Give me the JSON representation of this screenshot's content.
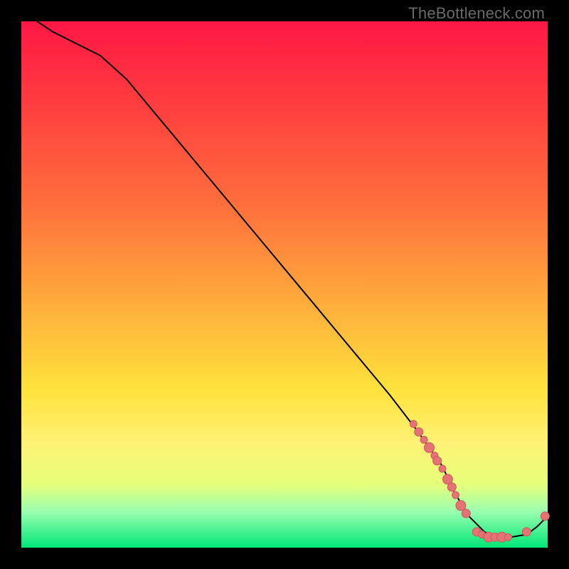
{
  "watermark": "TheBottleneck.com",
  "colors": {
    "line": "#000000",
    "dot_fill": "#e57373",
    "dot_stroke": "#c85a5a",
    "gradient_stops": [
      {
        "offset": 0.0,
        "color": "#ff1744"
      },
      {
        "offset": 0.15,
        "color": "#ff3b3f"
      },
      {
        "offset": 0.35,
        "color": "#ff6f3c"
      },
      {
        "offset": 0.55,
        "color": "#ffb13b"
      },
      {
        "offset": 0.7,
        "color": "#ffe23b"
      },
      {
        "offset": 0.8,
        "color": "#fff176"
      },
      {
        "offset": 0.88,
        "color": "#e6ff7a"
      },
      {
        "offset": 0.93,
        "color": "#9cffb0"
      },
      {
        "offset": 1.0,
        "color": "#00e676"
      }
    ]
  },
  "chart_data": {
    "type": "line",
    "title": "",
    "xlabel": "",
    "ylabel": "",
    "xlim": [
      0,
      100
    ],
    "ylim": [
      0,
      100
    ],
    "series": [
      {
        "name": "curve",
        "x": [
          3,
          6,
          10,
          15,
          20,
          25,
          30,
          35,
          40,
          45,
          50,
          55,
          60,
          65,
          70,
          75,
          80,
          82,
          85,
          88,
          90,
          93,
          96,
          98,
          100
        ],
        "y": [
          100,
          98,
          96,
          93.5,
          89,
          83,
          77,
          71,
          65,
          59,
          53,
          47,
          41,
          35,
          29,
          22.5,
          15.5,
          11,
          6,
          3,
          2,
          2,
          2.5,
          4,
          6
        ]
      }
    ],
    "scatter_clusters": [
      {
        "name": "descending-cluster",
        "points": [
          {
            "x": 74.5,
            "y": 23.5,
            "r": 5
          },
          {
            "x": 75.5,
            "y": 22.0,
            "r": 6
          },
          {
            "x": 76.5,
            "y": 20.5,
            "r": 5
          },
          {
            "x": 77.5,
            "y": 19.0,
            "r": 7
          },
          {
            "x": 78.5,
            "y": 17.5,
            "r": 5
          },
          {
            "x": 79.0,
            "y": 16.5,
            "r": 6
          },
          {
            "x": 80.0,
            "y": 15.0,
            "r": 5
          },
          {
            "x": 81.0,
            "y": 13.0,
            "r": 7
          },
          {
            "x": 81.8,
            "y": 11.5,
            "r": 6
          },
          {
            "x": 82.5,
            "y": 10.0,
            "r": 5
          }
        ]
      },
      {
        "name": "not-connected-descending",
        "points": [
          {
            "x": 83.5,
            "y": 8.0,
            "r": 7
          },
          {
            "x": 84.5,
            "y": 6.5,
            "r": 6
          }
        ]
      },
      {
        "name": "floor-cluster",
        "points": [
          {
            "x": 86.5,
            "y": 3.0,
            "r": 6
          },
          {
            "x": 87.5,
            "y": 2.5,
            "r": 5
          },
          {
            "x": 88.8,
            "y": 2.0,
            "r": 7
          },
          {
            "x": 90.0,
            "y": 2.0,
            "r": 6
          },
          {
            "x": 91.3,
            "y": 2.0,
            "r": 7
          },
          {
            "x": 92.5,
            "y": 2.0,
            "r": 5
          }
        ]
      },
      {
        "name": "one-isolated",
        "points": [
          {
            "x": 96.0,
            "y": 3.0,
            "r": 6
          }
        ]
      },
      {
        "name": "tail-up",
        "points": [
          {
            "x": 99.5,
            "y": 6.0,
            "r": 6
          }
        ]
      }
    ]
  }
}
